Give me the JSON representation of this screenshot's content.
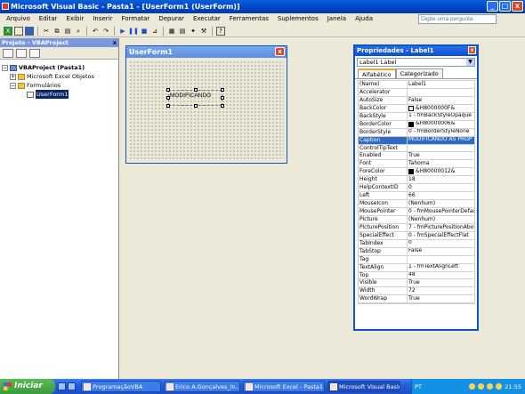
{
  "window": {
    "title": "Microsoft Visual Basic - Pasta1 - [UserForm1 (UserForm)]",
    "min": "_",
    "max": "□",
    "close": "x"
  },
  "menu": [
    "Arquivo",
    "Editar",
    "Exibir",
    "Inserir",
    "Formatar",
    "Depurar",
    "Executar",
    "Ferramentas",
    "Suplementos",
    "Janela",
    "Ajuda"
  ],
  "help_placeholder": "Digite uma pergunta",
  "project": {
    "title": "Projeto - VBAProject",
    "close": "x",
    "root": "VBAProject (Pasta1)",
    "excel": "Microsoft Excel Objetos",
    "forms": "Formulários",
    "form": "UserForm1"
  },
  "userform": {
    "title": "UserForm1",
    "close": "x",
    "label_text": "MODIFICANDO"
  },
  "properties": {
    "title": "Propriedades - Label1",
    "close": "x",
    "object": "Label1 Label",
    "tabs": [
      "Alfabético",
      "Categorizado"
    ],
    "rows": [
      {
        "name": "(Name)",
        "value": "Label1"
      },
      {
        "name": "Accelerator",
        "value": ""
      },
      {
        "name": "AutoSize",
        "value": "False"
      },
      {
        "name": "BackColor",
        "value": "&H8000000F&",
        "swatch": "#ece9d8"
      },
      {
        "name": "BackStyle",
        "value": "1 - fmBackStyleOpaque"
      },
      {
        "name": "BorderColor",
        "value": "&H80000006&",
        "swatch": "#000000"
      },
      {
        "name": "BorderStyle",
        "value": "0 - fmBorderStyleNone"
      },
      {
        "name": "Caption",
        "value": "MODIFICANDO AS PROP",
        "selected": true
      },
      {
        "name": "ControlTipText",
        "value": ""
      },
      {
        "name": "Enabled",
        "value": "True"
      },
      {
        "name": "Font",
        "value": "Tahoma"
      },
      {
        "name": "ForeColor",
        "value": "&H80000012&",
        "swatch": "#000000"
      },
      {
        "name": "Height",
        "value": "18"
      },
      {
        "name": "HelpContextID",
        "value": "0"
      },
      {
        "name": "Left",
        "value": "66"
      },
      {
        "name": "MouseIcon",
        "value": "(Nenhum)"
      },
      {
        "name": "MousePointer",
        "value": "0 - fmMousePointerDefau"
      },
      {
        "name": "Picture",
        "value": "(Nenhum)"
      },
      {
        "name": "PicturePosition",
        "value": "7 - fmPicturePositionAbov"
      },
      {
        "name": "SpecialEffect",
        "value": "0 - fmSpecialEffectFlat"
      },
      {
        "name": "TabIndex",
        "value": "0"
      },
      {
        "name": "TabStop",
        "value": "False"
      },
      {
        "name": "Tag",
        "value": ""
      },
      {
        "name": "TextAlign",
        "value": "1 - fmTextAlignLeft"
      },
      {
        "name": "Top",
        "value": "48"
      },
      {
        "name": "Visible",
        "value": "True"
      },
      {
        "name": "Width",
        "value": "72"
      },
      {
        "name": "WordWrap",
        "value": "True"
      }
    ]
  },
  "taskbar": {
    "start": "Iniciar",
    "tasks": [
      "ProgramaçãoVBA",
      "Erico A.Gonçalves_In...",
      "Microsoft Excel - Pasta1",
      "Microsoft Visual Basic ..."
    ],
    "lang": "PT",
    "clock": "21:55"
  }
}
